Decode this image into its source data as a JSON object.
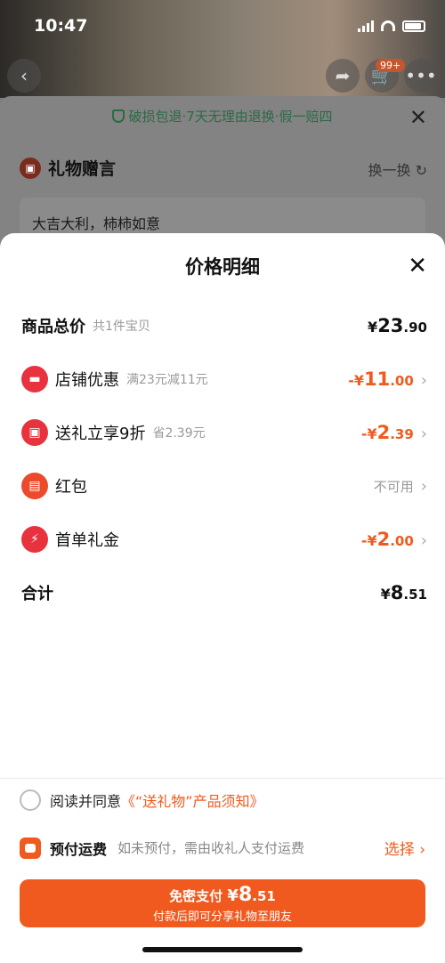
{
  "status": {
    "time": "10:47"
  },
  "background": {
    "cart_badge": "99+",
    "guarantee": "破损包退·7天无理由退换·假一赔四",
    "gift_message_title": "礼物赠言",
    "swap_label": "换一换",
    "gift_message_text": "大吉大利，柿柿如意"
  },
  "modal": {
    "title": "价格明细",
    "rows": [
      {
        "label": "商品总价",
        "sub": "共1件宝贝",
        "prefix": "¥",
        "int": "23",
        "dec": ".90"
      },
      {
        "label": "店铺优惠",
        "sub": "满23元减11元",
        "prefix": "-¥",
        "int": "11",
        "dec": ".00",
        "icon_color": "#e8323e"
      },
      {
        "label": "送礼立享9折",
        "sub": "省2.39元",
        "prefix": "-¥",
        "int": "2",
        "dec": ".39",
        "icon_color": "#e8323e"
      },
      {
        "label": "红包",
        "status": "不可用",
        "icon_color": "#ec4a2d"
      },
      {
        "label": "首单礼金",
        "prefix": "-¥",
        "int": "2",
        "dec": ".00",
        "icon_color": "#e8323e"
      }
    ],
    "total": {
      "label": "合计",
      "prefix": "¥",
      "int": "8",
      "dec": ".51"
    }
  },
  "footer": {
    "agree_text": "阅读并同意",
    "agree_link": "《“送礼物”产品须知》",
    "prepay_title": "预付运费",
    "prepay_desc": "如未预付，需由收礼人支付运费",
    "prepay_action": "选择 ›",
    "pay_label": "免密支付",
    "pay_prefix": "¥",
    "pay_int": "8",
    "pay_dec": ".51",
    "pay_sub": "付款后即可分享礼物至朋友"
  },
  "colors": {
    "accent": "#f15a1f",
    "discount_red": "#e8323e"
  }
}
